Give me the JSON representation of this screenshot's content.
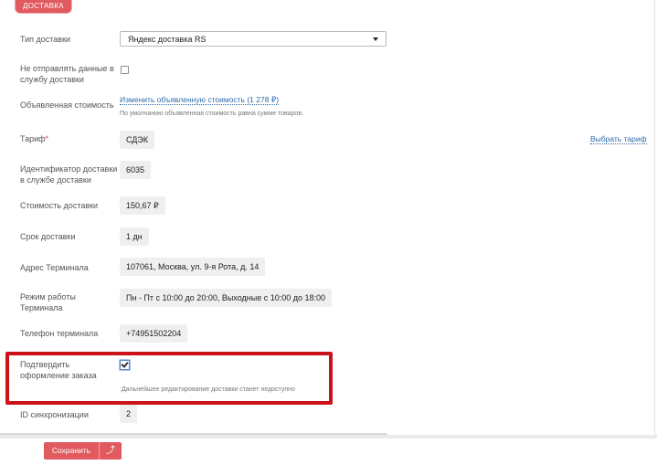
{
  "section_tag": "ДОСТАВКА",
  "fields": {
    "delivery_type": {
      "label": "Тип доставки",
      "value": "Яндекс доставка RS"
    },
    "no_send": {
      "label": "Не отправлять данные в службу доставки",
      "checked": false
    },
    "declared_value": {
      "label": "Объявленная стоимость",
      "link": "Изменить объявленную стоимость (1 278 ₽)",
      "hint": "По умолчанию объявленная стоимость равна сумме товаров."
    },
    "tariff": {
      "label": "Тариф",
      "required_mark": "*",
      "value": "СДЭК",
      "action": "Выбрать тариф"
    },
    "delivery_id": {
      "label": "Идентификатор доставки в службе доставки",
      "value": "6035"
    },
    "delivery_cost": {
      "label": "Стоимость доставки",
      "value": "150,67 ₽"
    },
    "delivery_term": {
      "label": "Срок доставки",
      "value": "1 дн"
    },
    "terminal_address": {
      "label": "Адрес Терминала",
      "value": "107061, Москва, ул. 9-я Рота, д. 14"
    },
    "terminal_hours": {
      "label": "Режим работы Терминала",
      "value": "Пн - Пт с 10:00 до 20:00, Выходные с 10:00 до 18:00"
    },
    "terminal_phone": {
      "label": "Телефон терминала",
      "value": "+74951502204"
    },
    "confirm_order": {
      "label": "Подтвердить оформление заказа",
      "checked": true,
      "hint": ":Дальнейшее редактирование доставки станет недоступно"
    },
    "sync_id": {
      "label": "ID синхронизации",
      "value": "2"
    }
  },
  "footer": {
    "save_label": "Сохранить",
    "up_icon": "arrow-up-icon"
  },
  "colors": {
    "accent": "#e05a5f",
    "highlight": "#cc1219",
    "link": "#2f6aa8"
  }
}
